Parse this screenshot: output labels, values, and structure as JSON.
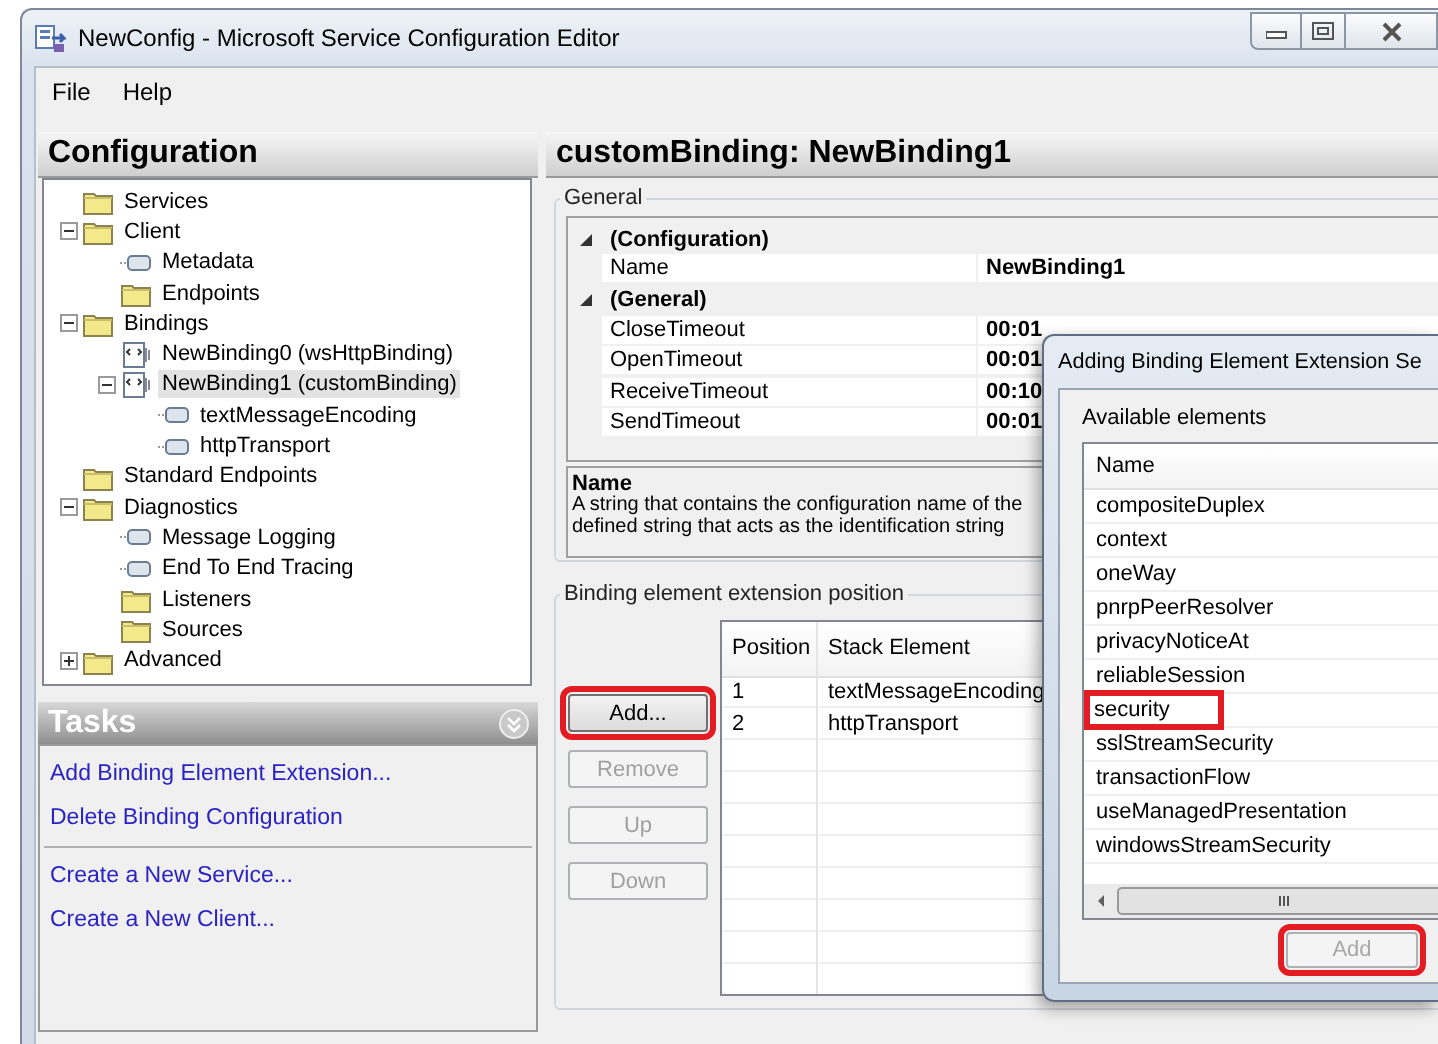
{
  "window": {
    "title": "NewConfig - Microsoft Service Configuration Editor"
  },
  "menu": [
    {
      "label": "File"
    },
    {
      "label": "Help"
    }
  ],
  "sidebar": {
    "title": "Configuration",
    "tree": [
      {
        "label": "Services",
        "kind": "folder",
        "selected": false
      },
      {
        "label": "Client",
        "kind": "folder",
        "selected": false,
        "expanded": true,
        "children": [
          {
            "label": "Metadata",
            "kind": "element",
            "selected": false
          },
          {
            "label": "Endpoints",
            "kind": "folder",
            "selected": false
          }
        ]
      },
      {
        "label": "Bindings",
        "kind": "folder",
        "selected": false,
        "expanded": true,
        "children": [
          {
            "label": "NewBinding0 (wsHttpBinding)",
            "kind": "binding",
            "selected": false
          },
          {
            "label": "NewBinding1 (customBinding)",
            "kind": "binding",
            "selected": true,
            "expanded": true,
            "children": [
              {
                "label": "textMessageEncoding",
                "kind": "element",
                "selected": false
              },
              {
                "label": "httpTransport",
                "kind": "element",
                "selected": false
              }
            ]
          }
        ]
      },
      {
        "label": "Standard Endpoints",
        "kind": "folder",
        "selected": false
      },
      {
        "label": "Diagnostics",
        "kind": "folder",
        "selected": false,
        "expanded": true,
        "children": [
          {
            "label": "Message Logging",
            "kind": "element",
            "selected": false
          },
          {
            "label": "End To End Tracing",
            "kind": "element",
            "selected": false
          },
          {
            "label": "Listeners",
            "kind": "folder",
            "selected": false
          },
          {
            "label": "Sources",
            "kind": "folder",
            "selected": false
          }
        ]
      },
      {
        "label": "Advanced",
        "kind": "folder",
        "selected": false,
        "expanded": false
      }
    ]
  },
  "tasks": {
    "title": "Tasks",
    "groups": [
      [
        {
          "label": "Add Binding Element Extension..."
        },
        {
          "label": "Delete Binding Configuration"
        }
      ],
      [
        {
          "label": "Create a New Service..."
        },
        {
          "label": "Create a New Client..."
        }
      ]
    ]
  },
  "content": {
    "title": "customBinding: NewBinding1",
    "general": {
      "label": "General",
      "categories": [
        {
          "name": "(Configuration)",
          "expanded": true,
          "properties": [
            {
              "name": "Name",
              "value": "NewBinding1"
            }
          ]
        },
        {
          "name": "(General)",
          "expanded": true,
          "properties": [
            {
              "name": "CloseTimeout",
              "value": "00:01"
            },
            {
              "name": "OpenTimeout",
              "value": "00:01"
            },
            {
              "name": "ReceiveTimeout",
              "value": "00:10"
            },
            {
              "name": "SendTimeout",
              "value": "00:01"
            }
          ]
        }
      ],
      "description": {
        "title": "Name",
        "text": "A string that contains the configuration name of the defined string that acts as the identification string"
      }
    },
    "binding_position": {
      "label": "Binding element extension position",
      "buttons": [
        {
          "label": "Add...",
          "disabled": false,
          "highlighted": true
        },
        {
          "label": "Remove",
          "disabled": true,
          "highlighted": false
        },
        {
          "label": "Up",
          "disabled": true,
          "highlighted": false
        },
        {
          "label": "Down",
          "disabled": true,
          "highlighted": false
        }
      ],
      "columns": [
        "Position",
        "Stack Element"
      ],
      "rows": [
        [
          "1",
          "textMessageEncoding"
        ],
        [
          "2",
          "httpTransport"
        ]
      ]
    }
  },
  "dialog": {
    "title": "Adding Binding Element Extension Se",
    "group_label": "Available elements",
    "column": "Name",
    "items": [
      {
        "label": "compositeDuplex",
        "selected": false,
        "highlighted": false
      },
      {
        "label": "context",
        "selected": false,
        "highlighted": false
      },
      {
        "label": "oneWay",
        "selected": false,
        "highlighted": false
      },
      {
        "label": "pnrpPeerResolver",
        "selected": false,
        "highlighted": false
      },
      {
        "label": "privacyNoticeAt",
        "selected": false,
        "highlighted": false
      },
      {
        "label": "reliableSession",
        "selected": false,
        "highlighted": false
      },
      {
        "label": "security",
        "selected": false,
        "highlighted": true
      },
      {
        "label": "sslStreamSecurity",
        "selected": false,
        "highlighted": false
      },
      {
        "label": "transactionFlow",
        "selected": false,
        "highlighted": false
      },
      {
        "label": "useManagedPresentation",
        "selected": false,
        "highlighted": false
      },
      {
        "label": "windowsStreamSecurity",
        "selected": false,
        "highlighted": false
      }
    ],
    "button": {
      "label": "Add",
      "disabled": true,
      "highlighted": true
    }
  }
}
